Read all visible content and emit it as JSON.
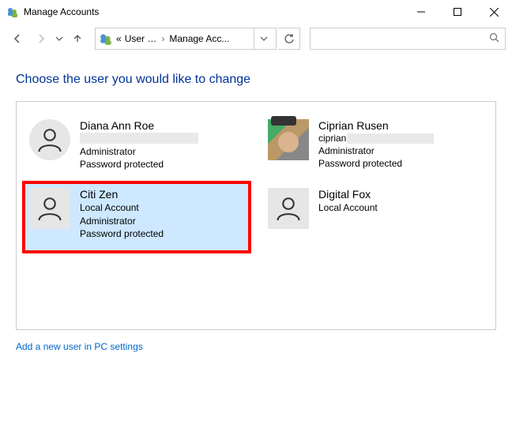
{
  "window": {
    "title": "Manage Accounts"
  },
  "breadcrumb": {
    "seg1": "User …",
    "seg2": "Manage Acc..."
  },
  "heading": "Choose the user you would like to change",
  "accounts": [
    {
      "name": "Diana Ann Roe",
      "email_prefix": "",
      "email_redacted": true,
      "lines": [
        "Administrator",
        "Password protected"
      ],
      "avatar": "generic",
      "selected": false,
      "highlighted": false
    },
    {
      "name": "Ciprian Rusen",
      "email_prefix": "ciprian",
      "email_redacted": true,
      "lines": [
        "Administrator",
        "Password protected"
      ],
      "avatar": "photo",
      "selected": false,
      "highlighted": false
    },
    {
      "name": "Citi Zen",
      "email_prefix": "",
      "email_redacted": false,
      "lines": [
        "Local Account",
        "Administrator",
        "Password protected"
      ],
      "avatar": "generic-square",
      "selected": true,
      "highlighted": true
    },
    {
      "name": "Digital Fox",
      "email_prefix": "",
      "email_redacted": false,
      "lines": [
        "Local Account"
      ],
      "avatar": "generic-square",
      "selected": false,
      "highlighted": false
    }
  ],
  "addLink": "Add a new user in PC settings"
}
